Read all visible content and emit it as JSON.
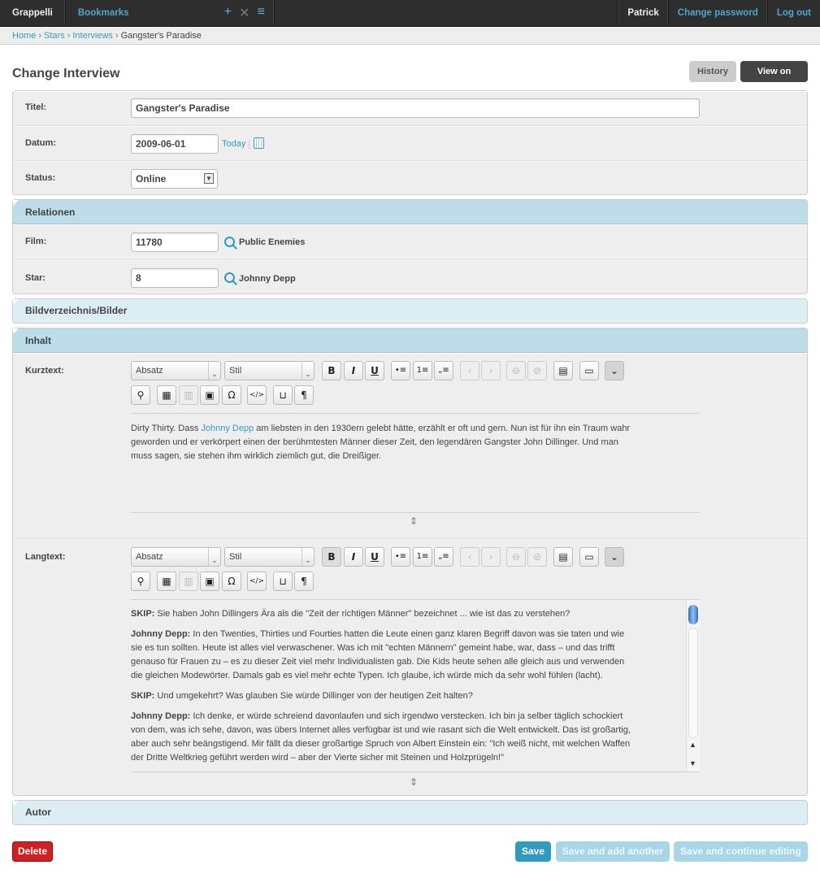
{
  "header": {
    "brand": "Grappelli",
    "bookmarks": "Bookmarks",
    "bookmark_icons": [
      "add-icon",
      "close-icon",
      "list-icon"
    ],
    "user": "Patrick",
    "change_password": "Change password",
    "logout": "Log out"
  },
  "breadcrumb": {
    "home": "Home",
    "stars": "Stars",
    "interviews": "Interviews",
    "current": "Gangster's Paradise",
    "separator": "›"
  },
  "page": {
    "title": "Change Interview",
    "history": "History",
    "view_on_site": "View on site"
  },
  "general": {
    "titel_label": "Titel:",
    "titel_value": "Gangster's Paradise",
    "datum_label": "Datum:",
    "datum_value": "2009-06-01",
    "today": "Today",
    "status_label": "Status:",
    "status_value": "Online"
  },
  "relationen": {
    "heading": "Relationen",
    "film_label": "Film:",
    "film_id": "11780",
    "film_name": "Public Enemies",
    "star_label": "Star:",
    "star_id": "8",
    "star_name": "Johnny Depp"
  },
  "bilder": {
    "heading": "Bildverzeichnis/Bilder"
  },
  "inhalt": {
    "heading": "Inhalt",
    "format_select": "Absatz",
    "style_select": "Stil",
    "kurztext": {
      "label": "Kurztext:",
      "text_before": "Dirty Thirty. Dass ",
      "link": "Johnny Depp",
      "text_after": " am liebsten in den 1930ern gelebt hätte, erzählt er oft und gern. Nun ist für ihn ein Traum wahr geworden und er verkörpert einen der berühmtesten Männer dieser Zeit, den legendären Gangster John Dillinger. Und man muss sagen, sie stehen ihm wirklich ziemlich gut, die Dreißiger."
    },
    "langtext": {
      "label": "Langtext:",
      "paragraphs": [
        {
          "speaker": "SKIP:",
          "text": " Sie haben John Dillingers Ära als die \"Zeit der richtigen Männer\" bezeichnet ... wie ist das zu verstehen?"
        },
        {
          "speaker": "Johnny Depp:",
          "text": " In den Twenties, Thirties und Fourties hatten die Leute einen ganz klaren Begriff davon was sie taten und wie sie es tun sollten. Heute ist alles viel verwaschener. Was ich mit \"echten Männern\" gemeint habe, war, dass – und das trifft genauso für Frauen zu – es zu dieser Zeit viel mehr Individualisten gab. Die Kids heute sehen alle gleich aus und verwenden die gleichen Modewörter. Damals gab es viel mehr echte Typen. Ich glaube, ich würde mich da sehr wohl fühlen (lacht)."
        },
        {
          "speaker": "SKIP:",
          "text": " Und umgekehrt? Was glauben Sie würde Dillinger von der heutigen Zeit halten?"
        },
        {
          "speaker": "Johnny Depp:",
          "text": " Ich denke, er würde schreiend davonlaufen und sich irgendwo verstecken. Ich bin ja selber täglich schockiert von dem, was ich sehe, davon, was übers Internet alles verfügbar ist und wie rasant sich die Welt entwickelt. Das ist großartig, aber auch sehr beängstigend. Mir fällt da dieser großartige Spruch von Albert Einstein ein: \"Ich weiß nicht, mit welchen Waffen der Dritte Weltkrieg geführt werden wird – aber der Vierte sicher mit Steinen und Holzprügeln!\""
        }
      ]
    },
    "toolbar_glyphs": {
      "bold": "B",
      "italic": "I",
      "underline": "U",
      "ul": "•≡",
      "ol": "1≡",
      "quote": "„≡",
      "prev": "‹",
      "next": "›",
      "link": "⊖",
      "unlink": "⊘",
      "media": "▤",
      "fullscreen": "▭",
      "more": "⌄",
      "search": "⚲",
      "paste": "▦",
      "table": "▥",
      "film": "▣",
      "omega": "Ω",
      "code": "</>",
      "box": "⊔",
      "pilcrow": "¶",
      "resize": "⇕",
      "scroll_up": "▲",
      "scroll_down": "▼"
    }
  },
  "autor": {
    "heading": "Autor"
  },
  "footer": {
    "delete": "Delete",
    "save": "Save",
    "save_add": "Save and add another",
    "save_continue": "Save and continue editing"
  },
  "colors": {
    "accent": "#309bbf",
    "danger": "#cc2222",
    "module_head": "#bcdde9"
  }
}
